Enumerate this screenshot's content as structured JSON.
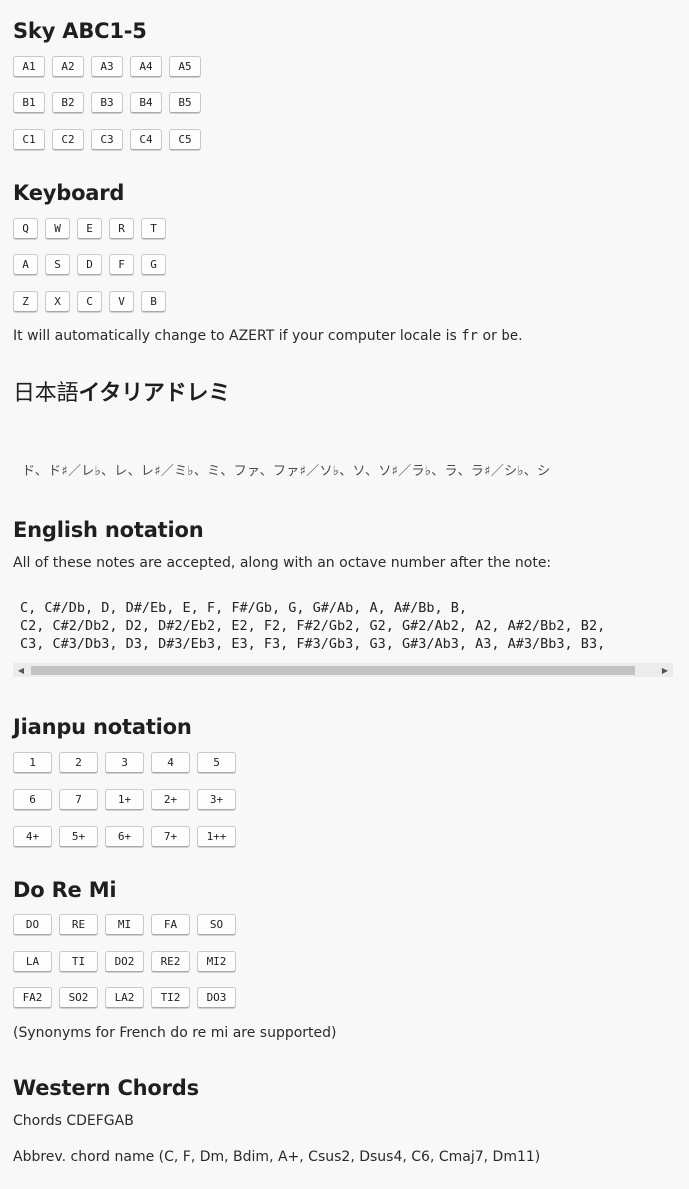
{
  "sky": {
    "title": "Sky ABC1-5",
    "rows": [
      [
        "A1",
        "A2",
        "A3",
        "A4",
        "A5"
      ],
      [
        "B1",
        "B2",
        "B3",
        "B4",
        "B5"
      ],
      [
        "C1",
        "C2",
        "C3",
        "C4",
        "C5"
      ]
    ]
  },
  "keyboard": {
    "title": "Keyboard",
    "rows": [
      [
        "Q",
        "W",
        "E",
        "R",
        "T"
      ],
      [
        "A",
        "S",
        "D",
        "F",
        "G"
      ],
      [
        "Z",
        "X",
        "C",
        "V",
        "B"
      ]
    ],
    "note_before": "It will automatically change to AZERT if your computer locale is ",
    "locale_fr": "fr",
    "note_middle": " or ",
    "locale_be": "be",
    "note_after": "."
  },
  "japanese": {
    "title_kanji": "日本語",
    "title_kana": "イタリアドレミ",
    "notes": "ド、ド♯／レ♭、レ、レ♯／ミ♭、ミ、ファ、ファ♯／ソ♭、ソ、ソ♯／ラ♭、ラ、ラ♯／シ♭、シ"
  },
  "english": {
    "title": "English notation",
    "description": "All of these notes are accepted, along with an octave number after the note:",
    "lines": [
      "C, C#/Db, D, D#/Eb, E, F, F#/Gb, G, G#/Ab, A, A#/Bb, B,",
      "C2, C#2/Db2, D2, D#2/Eb2, E2, F2, F#2/Gb2, G2, G#2/Ab2, A2, A#2/Bb2, B2,",
      "C3, C#3/Db3, D3, D#3/Eb3, E3, F3, F#3/Gb3, G3, G#3/Ab3, A3, A#3/Bb3, B3,"
    ]
  },
  "jianpu": {
    "title": "Jianpu notation",
    "rows": [
      [
        "1",
        "2",
        "3",
        "4",
        "5"
      ],
      [
        "6",
        "7",
        "1+",
        "2+",
        "3+"
      ],
      [
        "4+",
        "5+",
        "6+",
        "7+",
        "1++"
      ]
    ]
  },
  "doremi": {
    "title": "Do Re Mi",
    "rows": [
      [
        "DO",
        "RE",
        "MI",
        "FA",
        "SO"
      ],
      [
        "LA",
        "TI",
        "DO2",
        "RE2",
        "MI2"
      ],
      [
        "FA2",
        "SO2",
        "LA2",
        "TI2",
        "DO3"
      ]
    ],
    "note": "(Synonyms for French do re mi are supported)"
  },
  "chords": {
    "title": "Western Chords",
    "line1": "Chords CDEFGAB",
    "line2": "Abbrev. chord name (C, F, Dm, Bdim, A+, Csus2, Dsus4, C6, Cmaj7, Dm11)"
  }
}
